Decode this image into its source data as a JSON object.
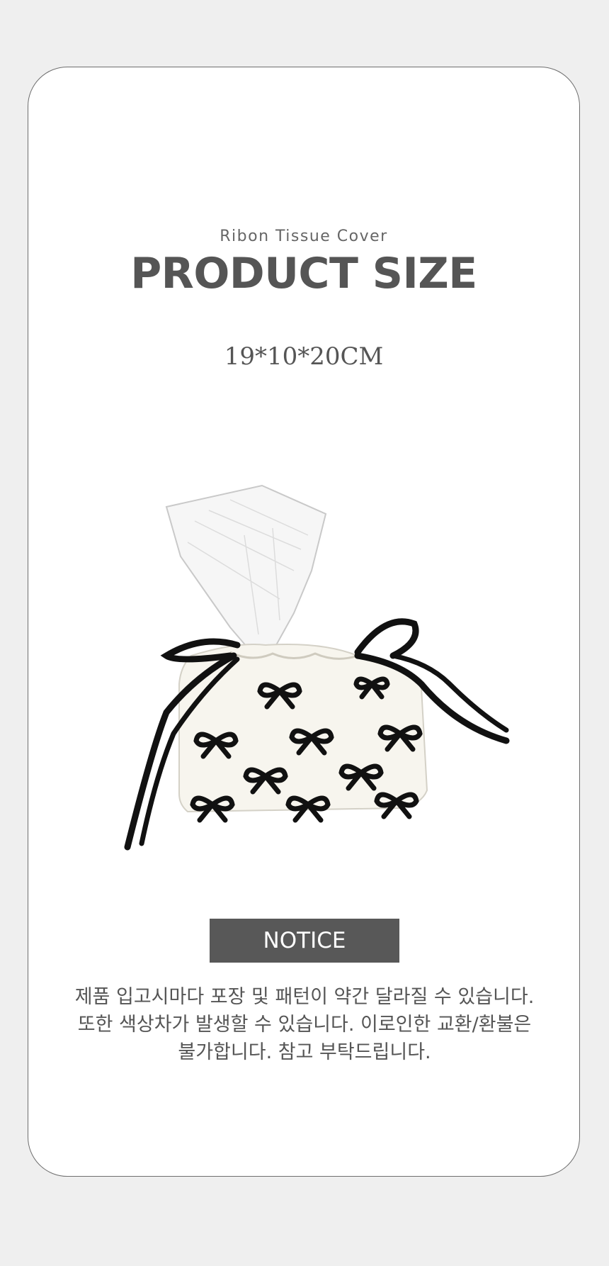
{
  "header": {
    "subtitle": "Ribon Tissue Cover",
    "title": "PRODUCT SIZE"
  },
  "size": {
    "dimensions": "19*10*20CM"
  },
  "product": {
    "image_icon": "ribbon-tissue-cover-illustration"
  },
  "notice": {
    "label": "NOTICE",
    "lines": [
      "제품 입고시마다 포장 및 패턴이 약간 달라질 수 있습니다.",
      "또한 색상차가 발생할 수 있습니다. 이로인한 교환/환불은",
      "불가합니다. 참고 부탁드립니다."
    ]
  },
  "colors": {
    "background": "#efefef",
    "card": "#ffffff",
    "title": "#555555",
    "notice_badge": "#585858"
  }
}
